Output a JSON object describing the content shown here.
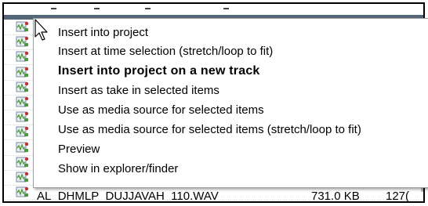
{
  "context_menu": {
    "items": [
      {
        "label": "Insert into project",
        "bold": false
      },
      {
        "label": "Insert at time selection (stretch/loop to fit)",
        "bold": false
      },
      {
        "label": "Insert into project on a new track",
        "bold": true
      },
      {
        "label": "Insert as take in selected items",
        "bold": false
      },
      {
        "label": "Use as media source for selected items",
        "bold": false
      },
      {
        "label": "Use as media source for selected items (stretch/loop to fit)",
        "bold": false
      },
      {
        "label": "Preview",
        "bold": false
      },
      {
        "label": "Show in explorer/finder",
        "bold": false
      }
    ]
  },
  "file_list": {
    "row_icon": "audio-file-icon",
    "partial_row": {
      "name": "AL_DHMLP_DUJJAVAH_110.WAV",
      "size": "731.0 KB",
      "extra": "127("
    }
  },
  "colors": {
    "header_bar": "#546778",
    "icon_green": "#4a9a3a",
    "icon_red": "#c43030"
  }
}
